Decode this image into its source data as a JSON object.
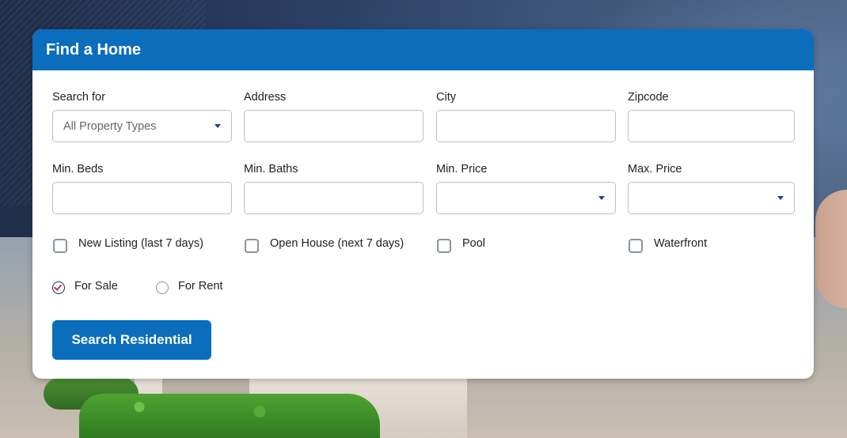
{
  "form": {
    "title": "Find a Home",
    "fields": {
      "search_for": {
        "label": "Search for",
        "value": "All Property Types"
      },
      "address": {
        "label": "Address",
        "value": ""
      },
      "city": {
        "label": "City",
        "value": ""
      },
      "zipcode": {
        "label": "Zipcode",
        "value": ""
      },
      "min_beds": {
        "label": "Min. Beds",
        "value": ""
      },
      "min_baths": {
        "label": "Min. Baths",
        "value": ""
      },
      "min_price": {
        "label": "Min. Price",
        "value": ""
      },
      "max_price": {
        "label": "Max. Price",
        "value": ""
      }
    },
    "checkboxes": [
      {
        "label": "New Listing (last 7 days)",
        "checked": false
      },
      {
        "label": "Open House (next 7 days)",
        "checked": false
      },
      {
        "label": "Pool",
        "checked": false
      },
      {
        "label": "Waterfront",
        "checked": false
      }
    ],
    "listing_type": {
      "options": [
        {
          "label": "For Sale",
          "selected": true
        },
        {
          "label": "For Rent",
          "selected": false
        }
      ]
    },
    "submit_label": "Search Residential"
  },
  "colors": {
    "header_bg": "#0a6ebd",
    "button_bg": "#0a6ebd",
    "caret": "#1b3f9a",
    "radio_check": "#c0392b"
  }
}
